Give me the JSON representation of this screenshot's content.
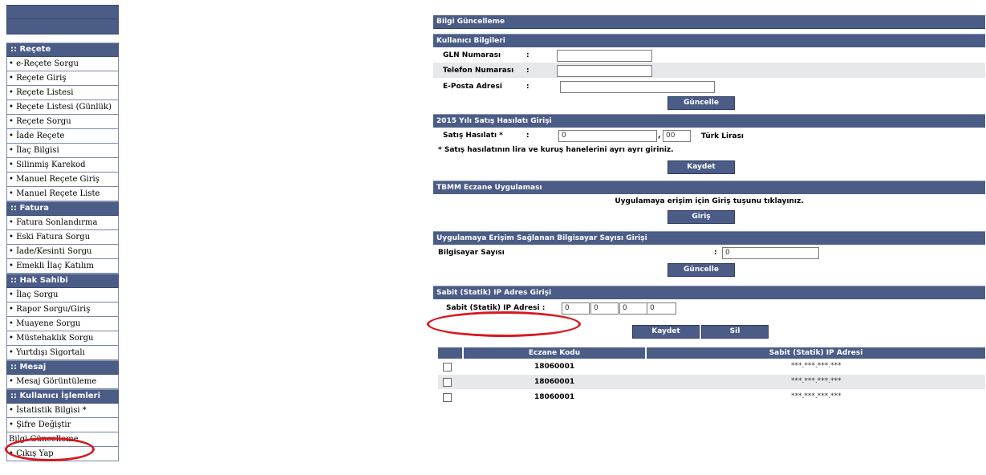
{
  "sidebar": {
    "sections": [
      {
        "title": ":: Reçete",
        "items": [
          "• e-Reçete Sorgu",
          "• Reçete Giriş",
          "• Reçete Listesi",
          "• Reçete Listesi (Günlük)",
          "• Reçete Sorgu",
          "• İade Reçete",
          "• İlaç Bilgisi",
          "• Silinmiş Karekod",
          "• Manuel Reçete Giriş",
          "• Manuel Reçete Liste"
        ]
      },
      {
        "title": ":: Fatura",
        "items": [
          "• Fatura Sonlandırma",
          "• Eski Fatura Sorgu",
          "• İade/Kesinti Sorgu",
          "• Emekli İlaç Katılım"
        ]
      },
      {
        "title": ":: Hak Sahibi",
        "items": [
          "• İlaç Sorgu",
          "• Rapor Sorgu/Giriş",
          "• Muayene Sorgu",
          "• Müstehaklık Sorgu",
          "• Yurtdışı Sigortalı"
        ]
      },
      {
        "title": ":: Mesaj",
        "items": [
          "• Mesaj Görüntüleme"
        ]
      },
      {
        "title": ":: Kullanıcı İşlemleri",
        "items": [
          "• İstatistik Bilgisi *",
          "• Şifre Değiştir",
          "Bilgi Güncelleme",
          "• Çıkış Yap"
        ]
      }
    ]
  },
  "main": {
    "title": "Bilgi Güncelleme",
    "user_info": {
      "header": "Kullanıcı Bilgileri",
      "gln_label": "GLN Numarası",
      "phone_label": "Telefon Numarası",
      "email_label": "E-Posta Adresi",
      "colon": ":",
      "gln_value": "",
      "phone_value": "",
      "email_value": "",
      "update_button": "Güncelle"
    },
    "sales": {
      "header": "2015 Yılı Satış Hasılatı Girişi",
      "label": "Satış Hasılatı *",
      "colon": ":",
      "lira_value": "0",
      "comma": ",",
      "kurus_value": "00",
      "currency": "Türk Lirası",
      "note": "* Satış hasılatının lira ve kuruş hanelerini ayrı ayrı giriniz.",
      "save_button": "Kaydet"
    },
    "tbmm": {
      "header": "TBMM Eczane Uygulaması",
      "message": "Uygulamaya erişim için Giriş tuşunu tıklayınız.",
      "login_button": "Giriş"
    },
    "computers": {
      "header": "Uygulamaya Erişim Sağlanan Bilgisayar Sayısı Girişi",
      "label": "Bilgisayar Sayısı",
      "colon": ":",
      "value": "0",
      "update_button": "Güncelle"
    },
    "static_ip": {
      "header": "Sabit (Statik) IP Adres Girişi",
      "label": "Sabit (Statik) IP Adresi :",
      "octets": [
        "0",
        "0",
        "0",
        "0"
      ],
      "save_button": "Kaydet",
      "delete_button": "Sil"
    },
    "table": {
      "col_kod": "Eczane Kodu",
      "col_ip": "Sabit (Statik) IP Adresi",
      "rows": [
        {
          "kod": "18060001",
          "ip": "***.***.***.***"
        },
        {
          "kod": "18060001",
          "ip": "***.***.***.***"
        },
        {
          "kod": "18060001",
          "ip": "***.***.***.***"
        }
      ]
    }
  }
}
